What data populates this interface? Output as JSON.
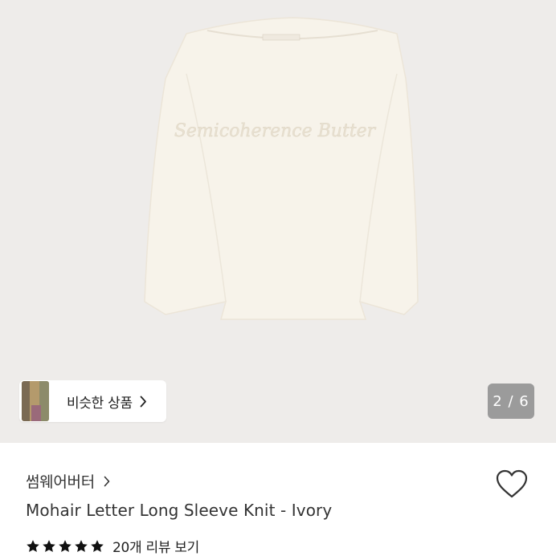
{
  "product_image": {
    "pager_current": "2",
    "pager_total": "6",
    "pager_text": "2 / 6",
    "background": "#eeecea",
    "garment_color": "#f7f3ea",
    "garment_label": "Semicoherence Butter"
  },
  "similar_products": {
    "label": "비슷한 상품"
  },
  "brand": {
    "name": "썸웨어버터"
  },
  "product": {
    "title": "Mohair Letter Long Sleeve Knit - Ivory",
    "wishlisted": false
  },
  "rating": {
    "stars": 5,
    "review_link_text": "20개 리뷰 보기"
  },
  "icons": {
    "similar_chevron": "chevron-right-icon",
    "brand_chevron": "chevron-right-icon",
    "wishlist": "heart-outline-icon",
    "star": "star-filled-icon"
  }
}
